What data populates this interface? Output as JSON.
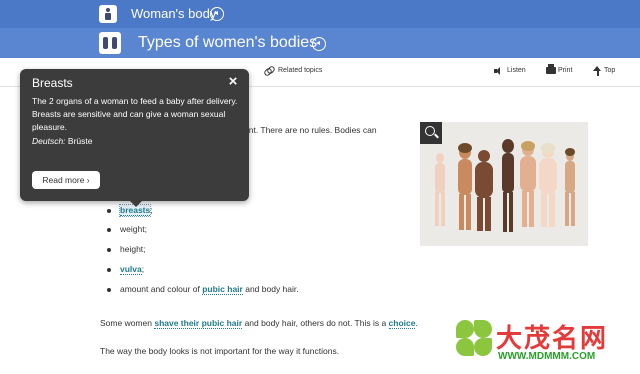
{
  "header": {
    "category_title": "Woman's body",
    "section_title": "Types of women's bodies"
  },
  "toolbar": {
    "related_topics": "Related topics",
    "listen": "Listen",
    "print": "Print",
    "top": "Top"
  },
  "tooltip": {
    "title": "Breasts",
    "close": "×",
    "body": "The 2 organs of a woman to feed a baby after delivery. Breasts are sensitive and can give a woman sexual pleasure.",
    "german_label": "Deutsch:",
    "german_word": "Brüste",
    "read_more": "Read more ›"
  },
  "content": {
    "intro_visible": "ent. There are no rules. Bodies can",
    "list": {
      "breasts": "breasts",
      "breasts_suffix": ";",
      "weight": "weight;",
      "height": "height;",
      "vulva": "vulva",
      "vulva_suffix": ";",
      "amount_prefix": "amount and colour of ",
      "pubic_hair": "pubic hair",
      "amount_suffix": " and body hair."
    },
    "p2": {
      "prefix": "Some women ",
      "link": "shave their pubic hair",
      "middle": " and body hair, others do not. This is a ",
      "choice": "choice",
      "suffix": "."
    },
    "p3": "The way the body looks is not important for the way it functions."
  },
  "figure": {
    "zoom_icon": "zoom-in-icon"
  },
  "watermark": {
    "brand": "大茂名网",
    "url": "WWW.MDMMM.COM"
  },
  "colors": {
    "topbar": "#4b78c7",
    "secbar": "#5a85d1",
    "link": "#1f7a8c",
    "tooltip": "#3c3c3c"
  }
}
